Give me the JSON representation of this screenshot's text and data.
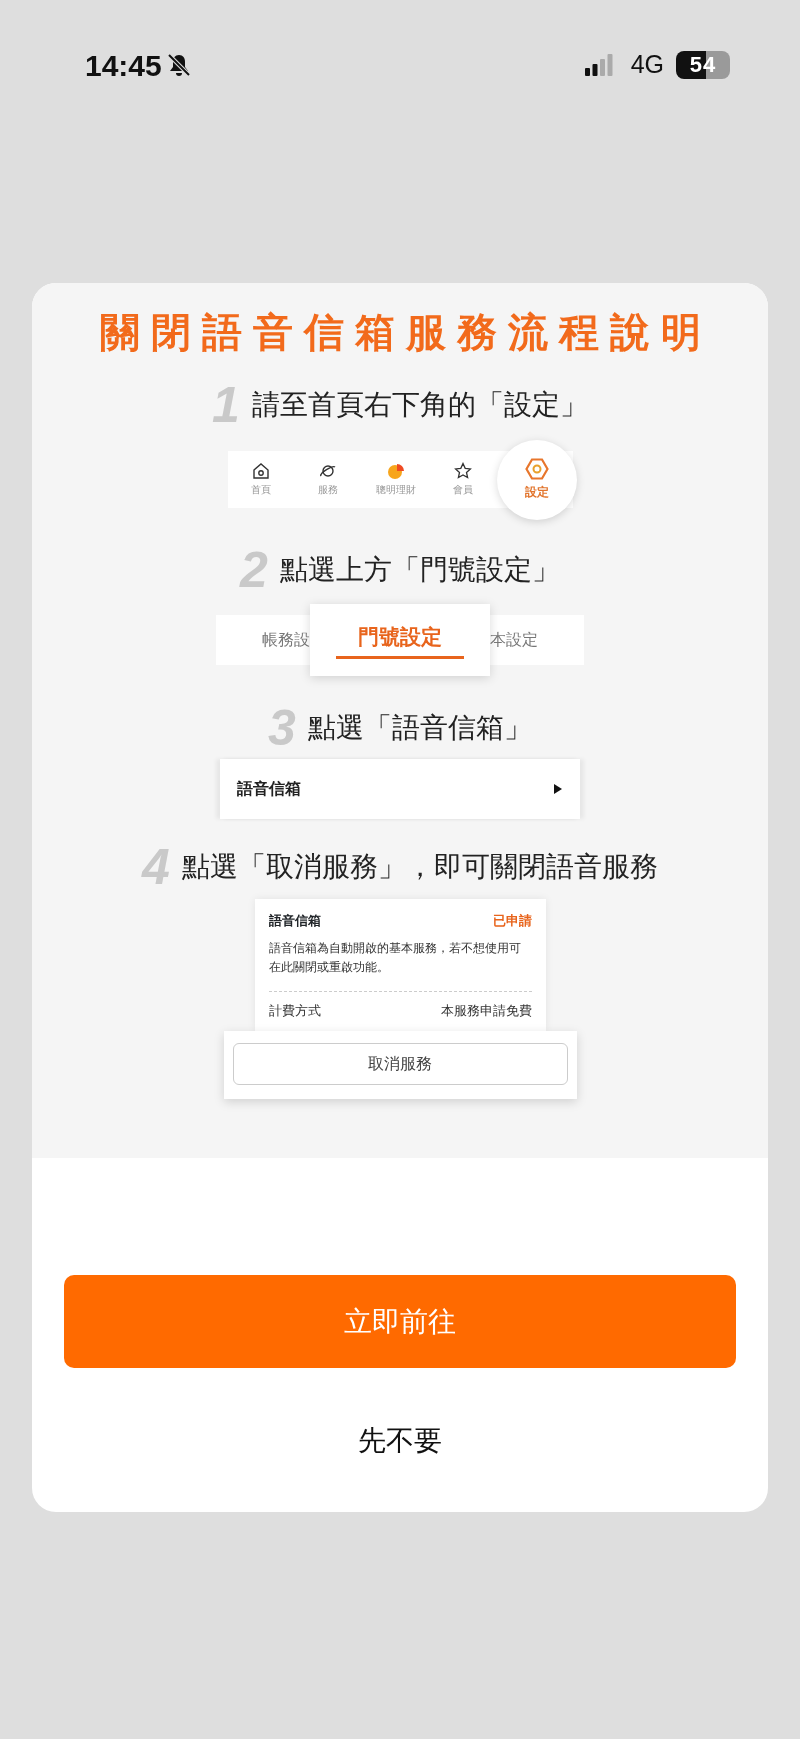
{
  "status_bar": {
    "time": "14:45",
    "bell_muted": true,
    "network": "4G",
    "battery": "54"
  },
  "dialog": {
    "title": "關閉語音信箱服務流程說明",
    "steps": [
      {
        "number": "1",
        "text": "請至首頁右下角的「設定」",
        "illustration": {
          "kind": "tabbar",
          "items": [
            {
              "label": "首頁",
              "selected": false
            },
            {
              "label": "服務",
              "selected": false
            },
            {
              "label": "聰明理財",
              "selected": false
            },
            {
              "label": "會員",
              "selected": false
            },
            {
              "label": "設定",
              "selected": true
            }
          ]
        }
      },
      {
        "number": "2",
        "text": "點選上方「門號設定」",
        "illustration": {
          "kind": "tabs",
          "items": [
            {
              "label": "帳務設",
              "selected": false
            },
            {
              "label": "門號設定",
              "selected": true
            },
            {
              "label": "本設定",
              "selected": false
            }
          ]
        }
      },
      {
        "number": "3",
        "text": "點選「語音信箱」",
        "illustration": {
          "kind": "row",
          "label": "語音信箱"
        }
      },
      {
        "number": "4",
        "text": "點選「取消服務」，即可關閉語音服務",
        "illustration": {
          "kind": "card",
          "title": "語音信箱",
          "status": "已申請",
          "description": "語音信箱為自動開啟的基本服務，若不想使用可在此關閉或重啟功能。",
          "fee_label": "計費方式",
          "fee_value": "本服務申請免費",
          "button": "取消服務"
        }
      }
    ],
    "primary_button": "立即前往",
    "secondary_button": "先不要"
  }
}
